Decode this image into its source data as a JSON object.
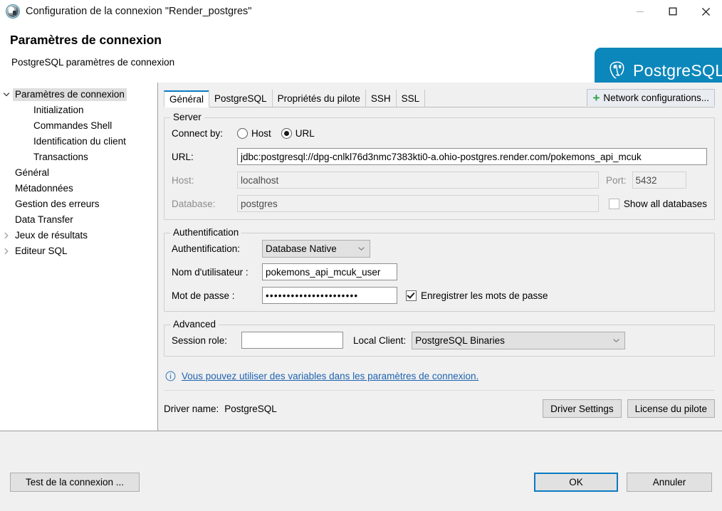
{
  "window": {
    "title": "Configuration de la connexion \"Render_postgres\"",
    "app_icon": "dbeaver-icon",
    "controls": {
      "minimize": "minimize-icon",
      "maximize": "maximize-icon",
      "close": "close-icon"
    }
  },
  "header": {
    "title": "Paramètres de connexion",
    "subtitle": "PostgreSQL paramètres de connexion",
    "banner_text": "PostgreSQL",
    "banner_color": "#0c87bb",
    "banner_logo": "postgresql-elephant-logo"
  },
  "sidebar": {
    "items": [
      {
        "label": "Paramètres de connexion",
        "level": 1,
        "twisty": "expanded",
        "selected": true
      },
      {
        "label": "Initialization",
        "level": 2,
        "twisty": "none",
        "selected": false
      },
      {
        "label": "Commandes Shell",
        "level": 2,
        "twisty": "none",
        "selected": false
      },
      {
        "label": "Identification du client",
        "level": 2,
        "twisty": "none",
        "selected": false
      },
      {
        "label": "Transactions",
        "level": 2,
        "twisty": "none",
        "selected": false
      },
      {
        "label": "Général",
        "level": 1,
        "twisty": "none",
        "selected": false
      },
      {
        "label": "Métadonnées",
        "level": 1,
        "twisty": "none",
        "selected": false
      },
      {
        "label": "Gestion des erreurs",
        "level": 1,
        "twisty": "none",
        "selected": false
      },
      {
        "label": "Data Transfer",
        "level": 1,
        "twisty": "none",
        "selected": false
      },
      {
        "label": "Jeux de résultats",
        "level": 1,
        "twisty": "collapsed",
        "selected": false
      },
      {
        "label": "Editeur SQL",
        "level": 1,
        "twisty": "collapsed",
        "selected": false
      }
    ]
  },
  "tabs": [
    {
      "label": "Général",
      "active": true
    },
    {
      "label": "PostgreSQL",
      "active": false
    },
    {
      "label": "Propriétés du pilote",
      "active": false
    },
    {
      "label": "SSH",
      "active": false
    },
    {
      "label": "SSL",
      "active": false
    }
  ],
  "network_configurations": {
    "label": "Network configurations...",
    "icon": "plus-icon",
    "icon_color": "#2f9e44"
  },
  "server": {
    "legend": "Server",
    "connect_by_label": "Connect by:",
    "radio_host": "Host",
    "radio_url": "URL",
    "selected_connect_by": "URL",
    "url_label": "URL:",
    "url_value": "jdbc:postgresql://dpg-cnlkl76d3nmc7383kti0-a.ohio-postgres.render.com/pokemons_api_mcuk",
    "host_label": "Host:",
    "host_value": "localhost",
    "port_label": "Port:",
    "port_value": "5432",
    "database_label": "Database:",
    "database_value": "postgres",
    "show_all_databases": "Show all databases",
    "show_all_databases_checked": false
  },
  "authentication": {
    "legend": "Authentification",
    "auth_label": "Authentification:",
    "auth_value": "Database Native",
    "auth_options": [
      "Database Native"
    ],
    "user_label": "Nom d'utilisateur :",
    "user_value": "pokemons_api_mcuk_user",
    "password_label": "Mot de passe :",
    "password_value": "••••••••••••••••••••••",
    "save_password_label": "Enregistrer les mots de passe",
    "save_password_checked": true
  },
  "advanced": {
    "legend": "Advanced",
    "session_role_label": "Session role:",
    "session_role_value": "",
    "local_client_label": "Local Client:",
    "local_client_value": "PostgreSQL Binaries",
    "local_client_options": [
      "PostgreSQL Binaries"
    ]
  },
  "info": {
    "icon": "info-icon",
    "link_text": "Vous pouvez utiliser des variables dans les paramètres de connexion."
  },
  "driver": {
    "name_label": "Driver name:",
    "name_value": "PostgreSQL",
    "settings_button": "Driver Settings",
    "license_button": "License du pilote"
  },
  "footer": {
    "test_button": "Test de la connexion ...",
    "ok_button": "OK",
    "cancel_button": "Annuler"
  }
}
